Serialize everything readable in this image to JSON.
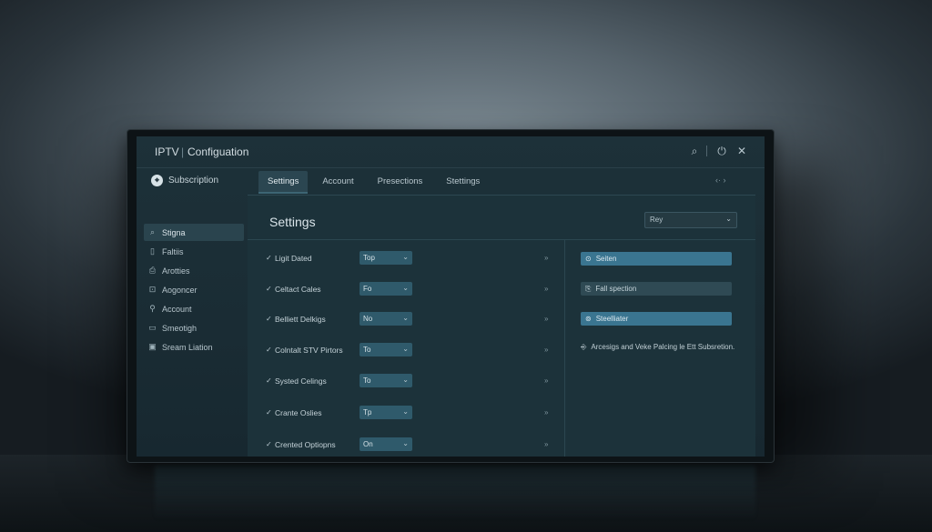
{
  "window": {
    "app_name": "IPTV",
    "separator": "|",
    "title": "Configuation",
    "icons": [
      "search-icon",
      "power-icon",
      "close-icon"
    ],
    "search_glyph": "⌕",
    "power_glyph": "⏻",
    "close_glyph": "✕"
  },
  "sidebar": {
    "header": "Subscription",
    "items": [
      {
        "label": "Stigna",
        "icon": "⌕",
        "active": true
      },
      {
        "label": "Faltiis",
        "icon": "▯"
      },
      {
        "label": "Arotties",
        "icon": "⎙"
      },
      {
        "label": "Aogoncer",
        "icon": "⊡"
      },
      {
        "label": "Account",
        "icon": "⚲"
      },
      {
        "label": "Smeotigh",
        "icon": "▭"
      },
      {
        "label": "Sream Liation",
        "icon": "▣"
      }
    ]
  },
  "tabs": [
    {
      "label": "Settings",
      "active": true
    },
    {
      "label": "Account"
    },
    {
      "label": "Presections"
    },
    {
      "label": "Stettings"
    }
  ],
  "tab_arrows": "‹· ›",
  "content": {
    "heading": "Settings",
    "top_select": {
      "value": "Rey",
      "chevron": "⌄"
    },
    "rows": [
      {
        "label": "Ligit Dated",
        "value": "Top",
        "chevron": "»"
      },
      {
        "label": "Celtact Cales",
        "value": "Fo",
        "chevron": "»"
      },
      {
        "label": "Belliett Delkigs",
        "value": "No",
        "chevron": "»"
      },
      {
        "label": "Colntalt STV Pirtors",
        "value": "To",
        "chevron": "»"
      },
      {
        "label": "Systed Celings",
        "value": "To",
        "chevron": "»"
      },
      {
        "label": "Crante Oslies",
        "value": "Tp",
        "chevron": "»"
      },
      {
        "label": "Crented Optiopns",
        "value": "On",
        "chevron": "»"
      }
    ],
    "right_panel": {
      "buttons": [
        {
          "label": "Seiten",
          "icon": "⊙",
          "style": "primary"
        },
        {
          "label": "Fall spection",
          "icon": "⎘",
          "style": "secondary"
        },
        {
          "label": "Steelliater",
          "icon": "⊚",
          "style": "primary"
        }
      ],
      "note": "Arcesigs and Veke Palcing le Ett Subsretion."
    }
  }
}
